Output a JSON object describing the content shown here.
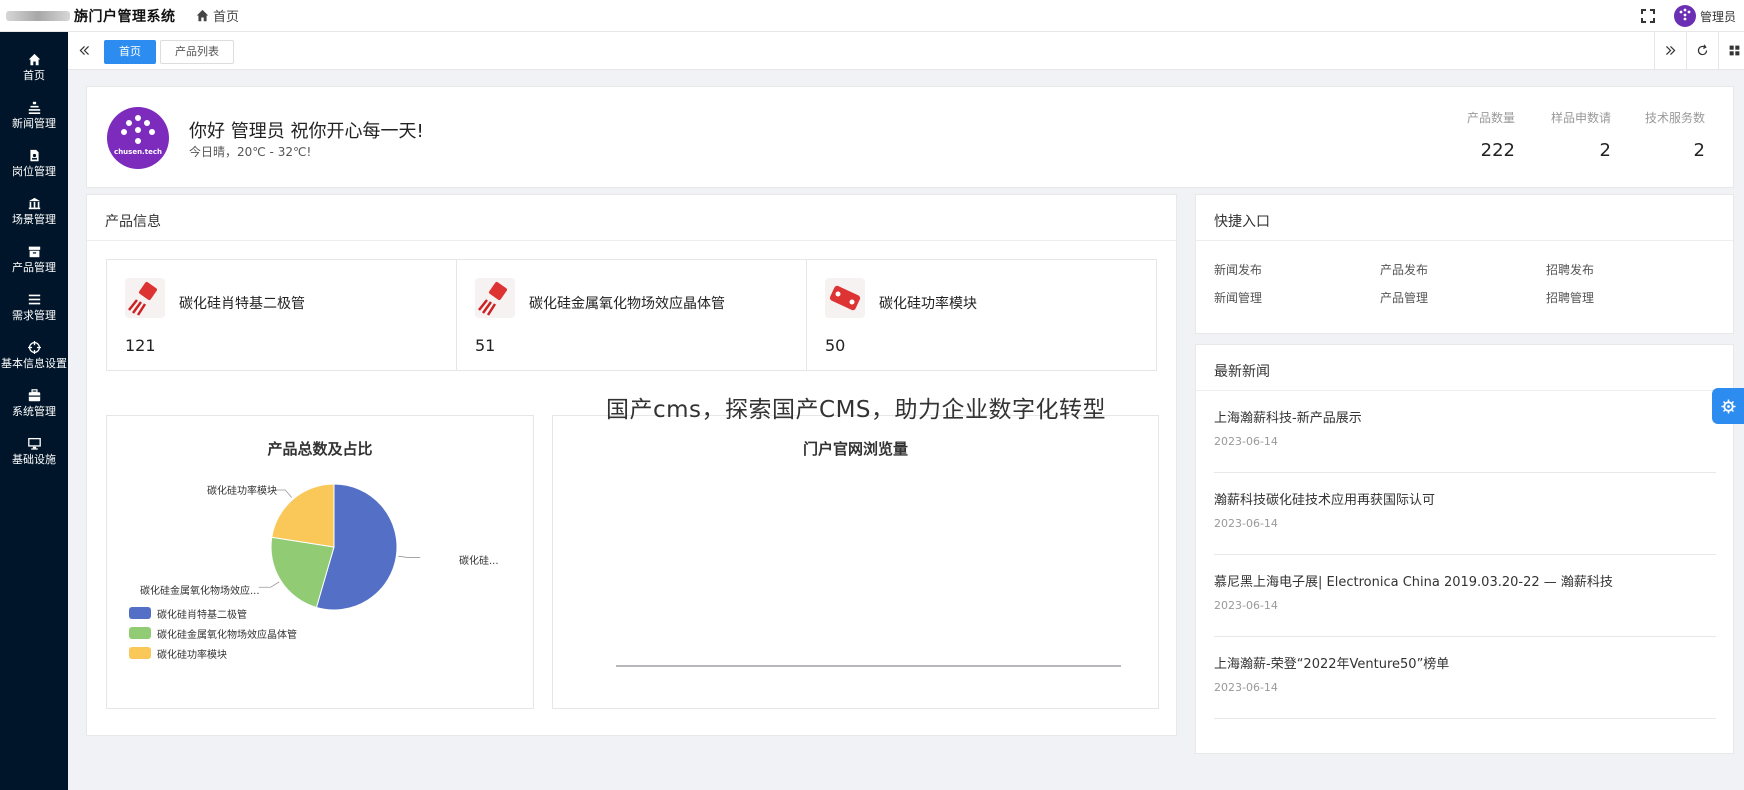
{
  "header": {
    "brand_blurred": "",
    "title": "旃门户管理系统",
    "home_crumb": "首页",
    "admin_name": "管理员"
  },
  "sidebar": {
    "items": [
      {
        "label": "首页",
        "icon": "home-icon"
      },
      {
        "label": "新闻管理",
        "icon": "news-icon"
      },
      {
        "label": "岗位管理",
        "icon": "job-icon"
      },
      {
        "label": "场景管理",
        "icon": "bank-icon"
      },
      {
        "label": "产品管理",
        "icon": "box-icon"
      },
      {
        "label": "需求管理",
        "icon": "list-icon"
      },
      {
        "label": "基本信息设置",
        "icon": "target-icon"
      },
      {
        "label": "系统管理",
        "icon": "briefcase-icon"
      },
      {
        "label": "基础设施",
        "icon": "monitor-icon"
      }
    ]
  },
  "tabs": {
    "active": "首页",
    "other": "产品列表"
  },
  "welcome": {
    "logo_text": "chusen.tech",
    "greeting": "你好 管理员 祝你开心每一天!",
    "weather": "今日晴，20℃ - 32℃!",
    "stats": [
      {
        "label": "产品数量",
        "value": "222"
      },
      {
        "label": "样品申数请",
        "value": "2"
      },
      {
        "label": "技术服务数",
        "value": "2"
      }
    ]
  },
  "products": {
    "title": "产品信息",
    "items": [
      {
        "name": "碳化硅肖特基二极管",
        "count": "121"
      },
      {
        "name": "碳化硅金属氧化物场效应晶体管",
        "count": "51"
      },
      {
        "name": "碳化硅功率模块",
        "count": "50"
      }
    ]
  },
  "pie_chart": {
    "title": "产品总数及占比",
    "label_left_top": "碳化硅功率模块",
    "label_left_bottom": "碳化硅金属氧化物场效应...",
    "label_right": "碳化硅...",
    "legend": [
      "碳化硅肖特基二极管",
      "碳化硅金属氧化物场效应晶体管",
      "碳化硅功率模块"
    ],
    "colors": [
      "#5470c6",
      "#91cc75",
      "#fac858"
    ]
  },
  "line_chart": {
    "title": "门户官网浏览量"
  },
  "chart_data": [
    {
      "type": "pie",
      "title": "产品总数及占比",
      "categories": [
        "碳化硅肖特基二极管",
        "碳化硅金属氧化物场效应晶体管",
        "碳化硅功率模块"
      ],
      "values": [
        121,
        51,
        50
      ],
      "legend": "bottom-left"
    },
    {
      "type": "line",
      "title": "门户官网浏览量",
      "x": [],
      "series": []
    }
  ],
  "quick": {
    "title": "快捷入口",
    "links": [
      "新闻发布",
      "产品发布",
      "招聘发布",
      "新闻管理",
      "产品管理",
      "招聘管理"
    ]
  },
  "news": {
    "title": "最新新闻",
    "items": [
      {
        "title": "上海瀚薪科技-新产品展示",
        "date": "2023-06-14"
      },
      {
        "title": "瀚薪科技碳化硅技术应用再获国际认可",
        "date": "2023-06-14"
      },
      {
        "title": "慕尼黑上海电子展| Electronica China 2019.03.20-22 — 瀚薪科技",
        "date": "2023-06-14"
      },
      {
        "title": "上海瀚薪-荣登“2022年Venture50”榜单",
        "date": "2023-06-14"
      }
    ]
  },
  "caption": "国产cms，探索国产CMS，助力企业数字化转型"
}
